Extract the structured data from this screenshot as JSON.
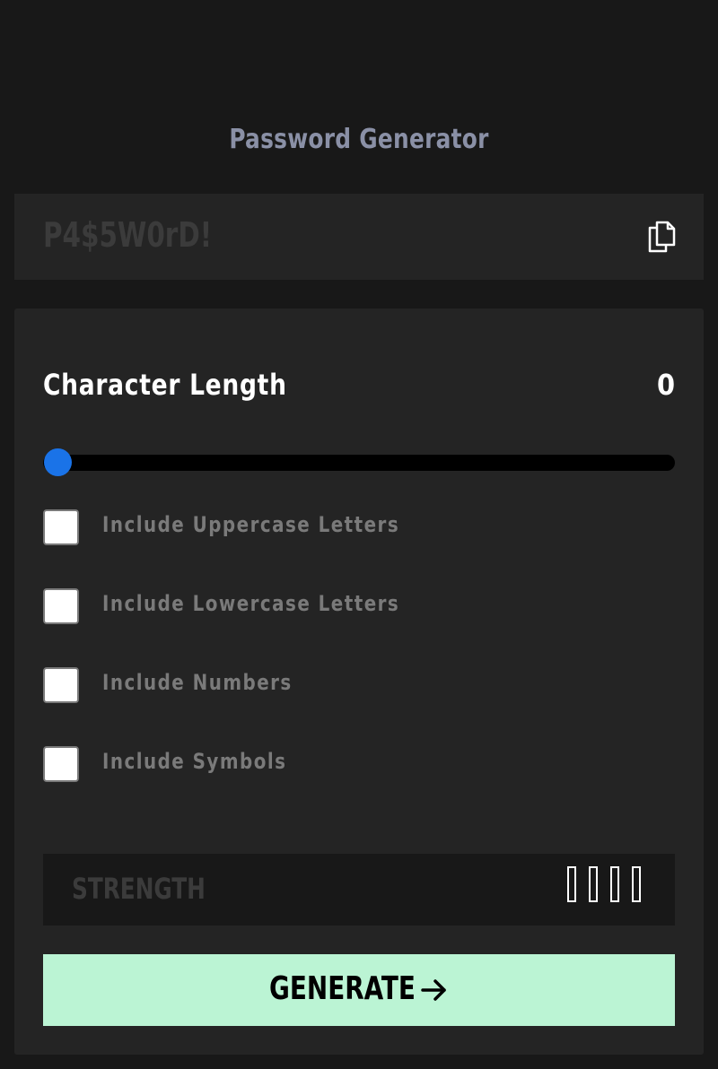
{
  "app": {
    "title": "Password Generator"
  },
  "output": {
    "password_placeholder": "P4$5W0rD!",
    "copy_icon": "copy-icon"
  },
  "settings": {
    "length_label": "Character Length",
    "length_value": "0",
    "slider_value": 0,
    "options": [
      {
        "label": "Include Uppercase Letters",
        "checked": false
      },
      {
        "label": "Include Lowercase Letters",
        "checked": false
      },
      {
        "label": "Include Numbers",
        "checked": false
      },
      {
        "label": "Include Symbols",
        "checked": false
      }
    ]
  },
  "strength": {
    "label": "STRENGTH",
    "level": 0,
    "bar_count": 4
  },
  "generate": {
    "label": "GENERATE",
    "icon": "arrow-right-icon"
  },
  "colors": {
    "background": "#181818",
    "panel": "#242424",
    "accent": "#1a73e8",
    "button": "#bbf4d4",
    "title": "#8a90a6",
    "muted_text": "#7a7a7a",
    "placeholder_text": "#3b3b3b"
  }
}
